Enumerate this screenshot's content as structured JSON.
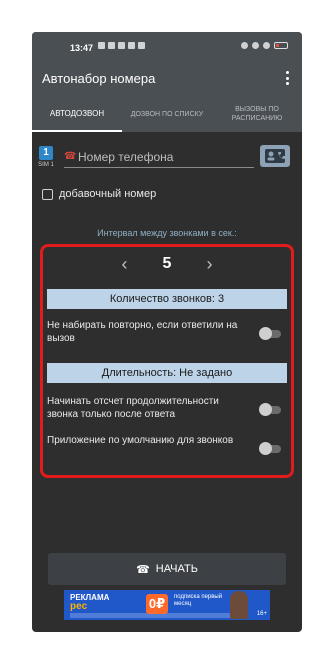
{
  "status_bar": {
    "time": "13:47"
  },
  "app": {
    "title": "Автонабор номера",
    "tabs": [
      {
        "label": "Автодозвон",
        "active": true
      },
      {
        "label": "Дозвон по списку",
        "active": false
      },
      {
        "label": "Вызовы по расписанию",
        "active": false
      }
    ]
  },
  "sim": {
    "number": "1",
    "label": "SIM 1"
  },
  "phone": {
    "placeholder": "Номер телефона"
  },
  "extension": {
    "label": "добавочный номер",
    "checked": false
  },
  "interval": {
    "label": "Интервал между звонками в сек.:",
    "value": "5"
  },
  "settings": {
    "calls_count_label": "Количество звонков:  3",
    "no_redial_label": "Не набирать повторно, если ответили на вызов",
    "duration_label": "Длительность: Не задано",
    "count_after_answer_label": "Начинать отсчет продолжительности звонка только после ответа",
    "default_app_label": "Приложение по умолчанию для звонков"
  },
  "start_button": {
    "label": "НАЧАТЬ"
  },
  "ad": {
    "brand_top": "РЕКЛАМА",
    "brand": "pec",
    "badge": "0₽",
    "promo": "подписка первый месяц",
    "age": "16+"
  },
  "colors": {
    "accent_red": "#e01c1c",
    "bar_bg": "#bdd3e8",
    "sim_blue": "#2f86c9"
  }
}
